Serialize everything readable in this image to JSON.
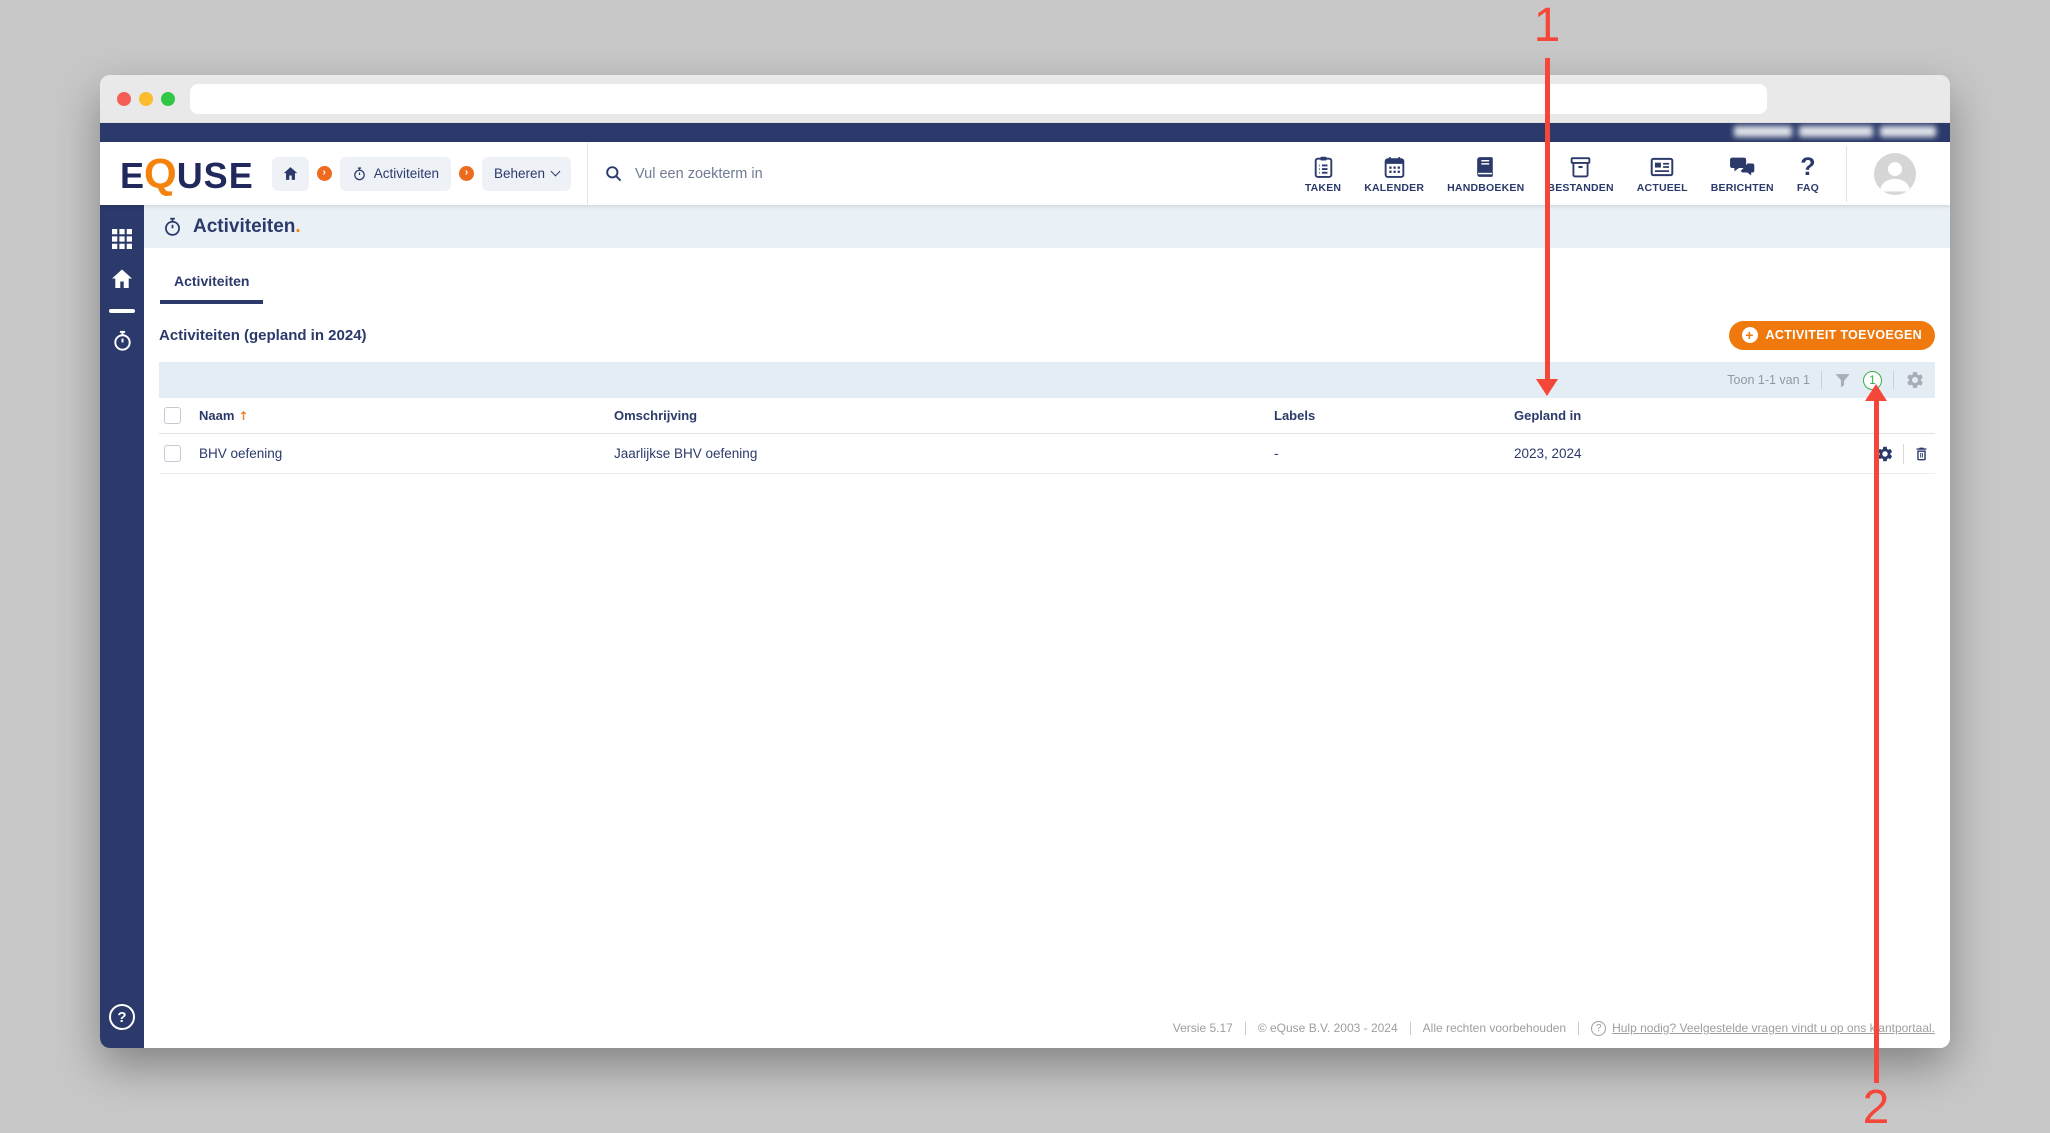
{
  "colors": {
    "navy": "#2b3a6b",
    "orange": "#f0790e",
    "arrow_red": "#f4473a",
    "badge_green": "#3cab4e"
  },
  "browser": {
    "url": ""
  },
  "header": {
    "logo": {
      "pre": "E",
      "q": "Q",
      "post": "USE"
    },
    "breadcrumb": {
      "items": [
        {
          "label": "Activiteiten"
        },
        {
          "label": "Beheren"
        }
      ]
    },
    "search_placeholder": "Vul een zoekterm in",
    "nav": [
      {
        "label": "TAKEN"
      },
      {
        "label": "KALENDER"
      },
      {
        "label": "HANDBOEKEN"
      },
      {
        "label": "BESTANDEN"
      },
      {
        "label": "ACTUEEL"
      },
      {
        "label": "BERICHTEN"
      },
      {
        "label": "FAQ"
      }
    ]
  },
  "page": {
    "title": "Activiteiten",
    "title_dot": ".",
    "tab_label": "Activiteiten",
    "section_title": "Activiteiten (gepland in 2024)",
    "add_button_label": "ACTIVITEIT TOEVOEGEN",
    "toolbar": {
      "shown_text": "Toon 1-1 van 1",
      "filter_count": "1"
    },
    "table": {
      "headers": {
        "naam": "Naam",
        "omschrijving": "Omschrijving",
        "labels": "Labels",
        "gepland_in": "Gepland in"
      },
      "rows": [
        {
          "naam": "BHV oefening",
          "omschrijving": "Jaarlijkse BHV oefening",
          "labels": "-",
          "gepland_in": "2023, 2024"
        }
      ]
    }
  },
  "footer": {
    "version": "Versie 5.17",
    "copyright": "© eQuse B.V. 2003 - 2024",
    "rights": "Alle rechten voorbehouden",
    "help_link": "Hulp nodig? Veelgestelde vragen vindt u op ons klantportaal."
  },
  "icons": {
    "plus": "+",
    "question": "?",
    "sort_asc": "↑",
    "chevron": "›"
  },
  "annotations": {
    "arrow_1": "1",
    "arrow_2": "2"
  }
}
